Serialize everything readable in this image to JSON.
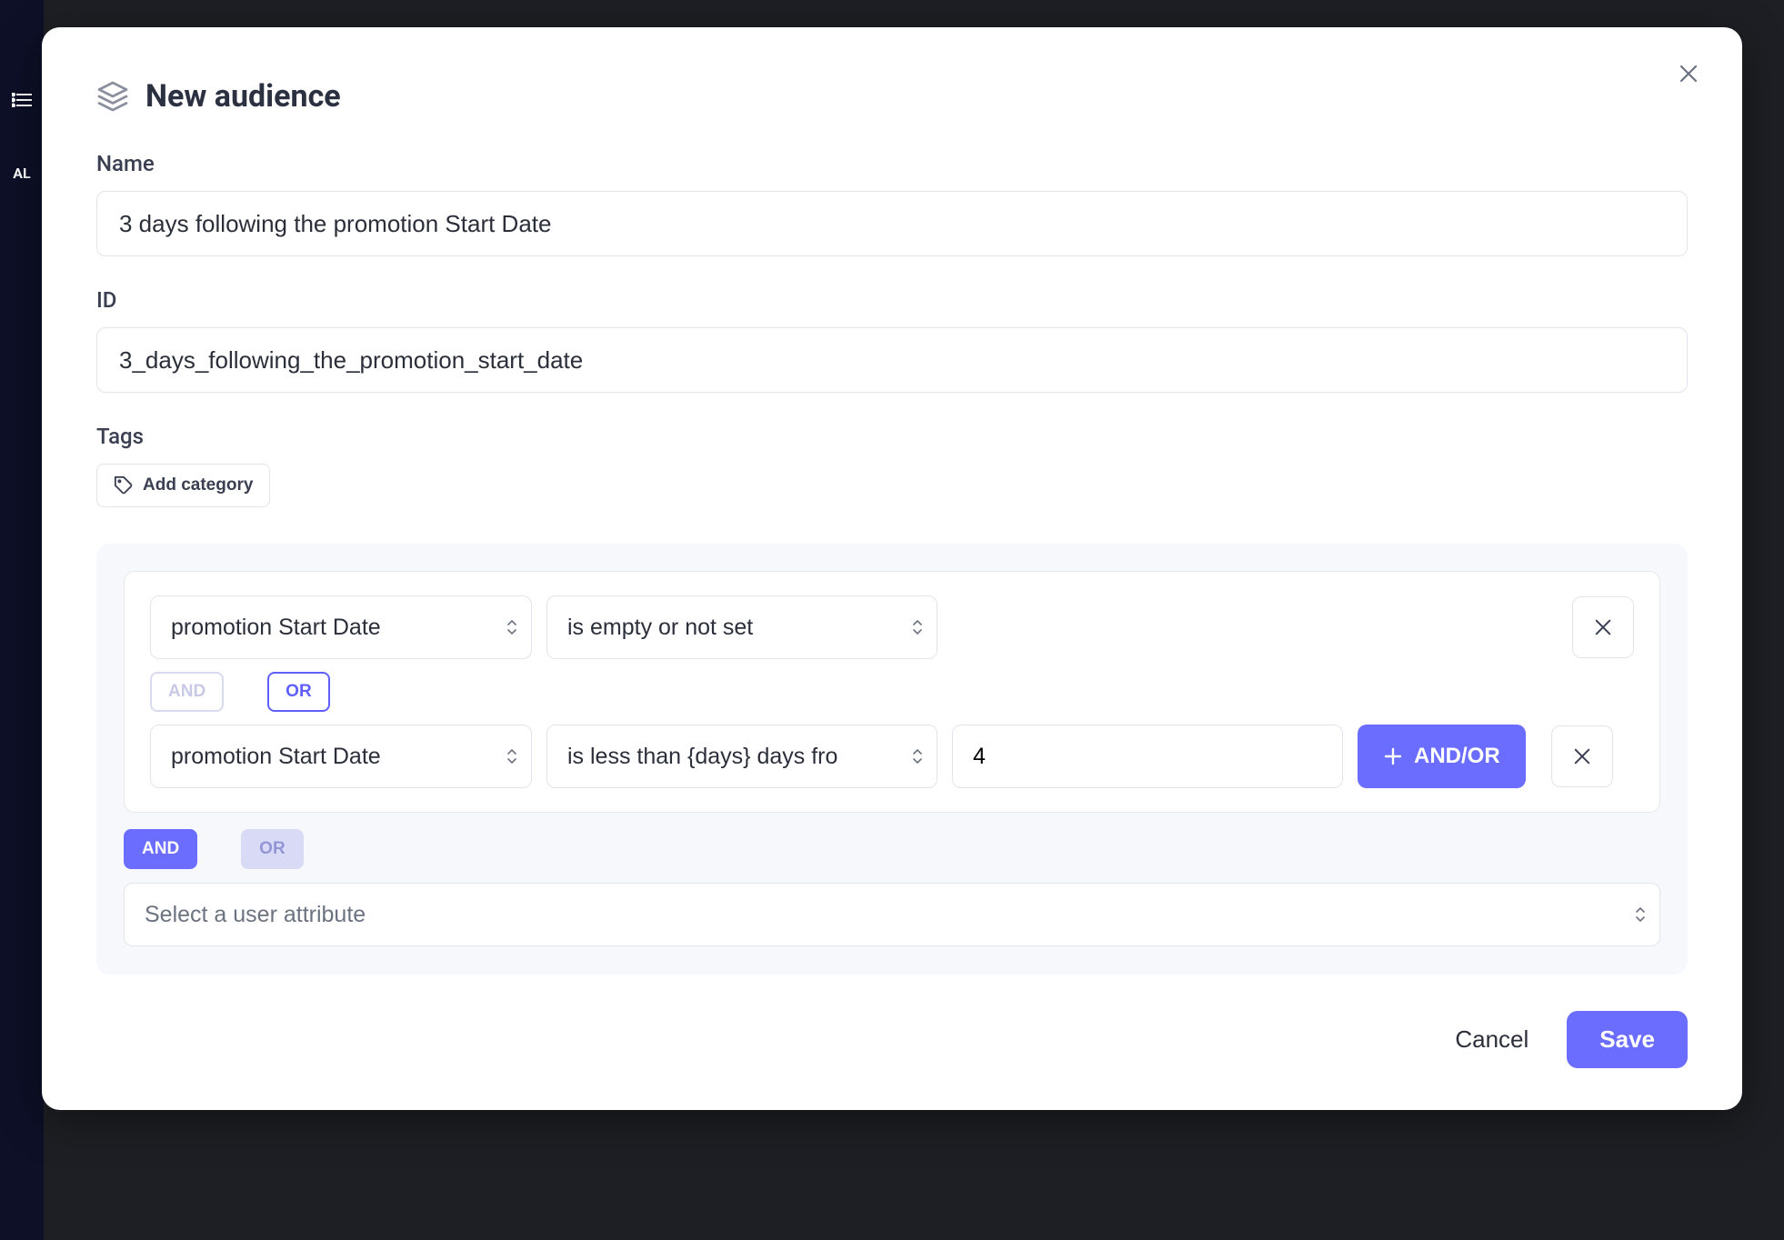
{
  "backdrop": {
    "item0_label": "AL"
  },
  "modal": {
    "title": "New audience"
  },
  "fields": {
    "name_label": "Name",
    "name_value": "3 days following the promotion Start Date",
    "id_label": "ID",
    "id_value": "3_days_following_the_promotion_start_date",
    "tags_label": "Tags",
    "add_category_label": "Add category"
  },
  "rules": {
    "group0": {
      "row0": {
        "attribute": "promotion Start Date",
        "operator": "is empty or not set"
      },
      "connector": {
        "and_label": "AND",
        "or_label": "OR"
      },
      "row1": {
        "attribute": "promotion Start Date",
        "operator": "is less than {days} days fro",
        "value": "4",
        "add_label": "AND/OR"
      }
    },
    "outer_connector": {
      "and_label": "AND",
      "or_label": "OR"
    },
    "placeholder_attribute": "Select a user attribute"
  },
  "footer": {
    "cancel_label": "Cancel",
    "save_label": "Save"
  }
}
